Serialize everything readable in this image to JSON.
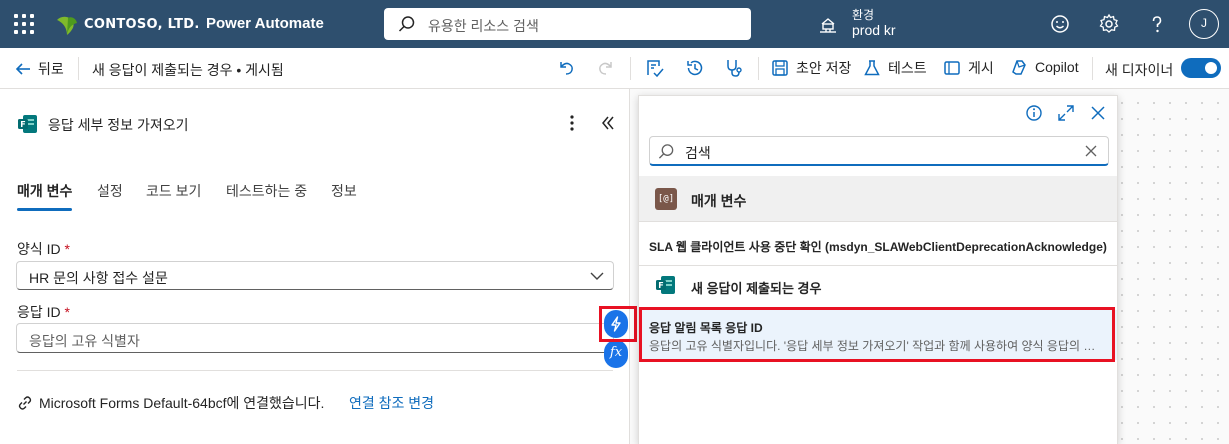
{
  "header": {
    "brand": "CONTOSO, LTD.",
    "app_title": "Power Automate",
    "search_placeholder": "유용한 리소스 검색",
    "environment_label": "환경",
    "environment_name": "prod kr",
    "avatar_initial": "J",
    "brand_color": "#2e4f6e",
    "icons": [
      "waffle-icon",
      "leaf-icon",
      "search-icon",
      "environment-icon",
      "smiley-icon",
      "gear-icon",
      "help-icon"
    ]
  },
  "command_bar": {
    "back_label": "뒤로",
    "flow_title": "새 응답이 제출되는 경우 • 게시됨",
    "save_draft": "초안 저장",
    "test": "테스트",
    "publish": "게시",
    "copilot": "Copilot",
    "new_designer": "새 디자이너",
    "new_designer_on": true,
    "icons": [
      "undo-icon",
      "redo-icon",
      "flow-checker-icon",
      "history-icon",
      "stethoscope-icon",
      "save-icon",
      "flask-icon",
      "publish-icon",
      "copilot-icon"
    ]
  },
  "action_panel": {
    "title": "응답 세부 정보 가져오기",
    "tabs": [
      {
        "label": "매개 변수",
        "active": true
      },
      {
        "label": "설정",
        "active": false
      },
      {
        "label": "코드 보기",
        "active": false
      },
      {
        "label": "테스트하는 중",
        "active": false
      },
      {
        "label": "정보",
        "active": false
      }
    ],
    "form_id": {
      "label": "양식 ID",
      "required_mark": "*",
      "value": "HR 문의 사항 접수 설문"
    },
    "response_id": {
      "label": "응답 ID",
      "required_mark": "*",
      "placeholder": "응답의 고유 식별자"
    },
    "connection_text": "Microsoft Forms Default-64bcf에 연결했습니다.",
    "change_connection": "연결 참조 변경",
    "fx_label": "fx"
  },
  "dynamic_content": {
    "search_value": "검색",
    "section_params": {
      "badge": "[@]",
      "label": "매개 변수"
    },
    "sla_item": "SLA 웹 클라이언트 사용 중단 확인 (msdyn_SLAWebClientDeprecationAcknowledge)",
    "trigger_section": "새 응답이 제출되는 경우",
    "selected_item": {
      "title": "응답 알림 목록 응답 ID",
      "description": "응답의 고유 식별자입니다. '응답 세부 정보 가져오기' 작업과 함께 사용하여 양식 응답의 콘텐츠를 가져옵니다."
    },
    "highlight_color": "#e81123",
    "accent_color": "#0f6cbd"
  }
}
